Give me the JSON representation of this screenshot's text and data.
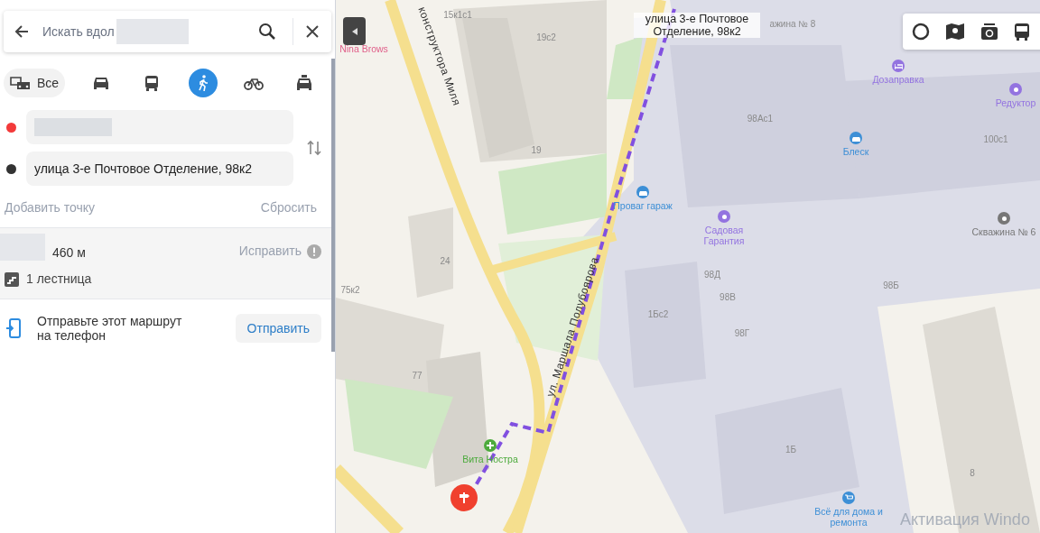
{
  "search": {
    "placeholder": "Искать вдол"
  },
  "modes": [
    {
      "kind": "all",
      "label": "Все",
      "selected": false
    },
    {
      "kind": "car",
      "selected": false
    },
    {
      "kind": "bus",
      "selected": false
    },
    {
      "kind": "walk",
      "selected": true
    },
    {
      "kind": "bike",
      "selected": false
    },
    {
      "kind": "taxi",
      "selected": false
    }
  ],
  "points": [
    {
      "color": "#f33a3a"
    },
    {
      "color": "#333333",
      "value": "улица 3-е Почтовое Отделение, 98к2"
    }
  ],
  "add_point": "Добавить точку",
  "reset": "Сбросить",
  "route": {
    "distance": "460 м",
    "fix": "Исправить",
    "stairs": "1 лестница"
  },
  "send": {
    "text": "Отправьте этот маршрут на телефон",
    "button": "Отправить"
  },
  "map_labels": [
    {
      "kind": "house",
      "text": "15к1с1"
    },
    {
      "kind": "house",
      "text": "19с2"
    },
    {
      "kind": "poi",
      "text": "Nina Brows",
      "color": "#e0608a"
    },
    {
      "kind": "street",
      "text": "конструктора Миля"
    },
    {
      "kind": "address",
      "text": "улица 3-е Почтовое Отделение, 98к2"
    },
    {
      "kind": "house",
      "text": "ажина № 8"
    },
    {
      "kind": "poi",
      "text": "Дозаправка",
      "color": "#9373e0"
    },
    {
      "kind": "poi",
      "text": "Редуктор",
      "color": "#9373e0"
    },
    {
      "kind": "house",
      "text": "98Ас1"
    },
    {
      "kind": "poi",
      "text": "Блеск",
      "color": "#3d8fd6"
    },
    {
      "kind": "house",
      "text": "100с1"
    },
    {
      "kind": "poi",
      "text": "Проваг гараж",
      "color": "#3d8fd6"
    },
    {
      "kind": "house",
      "text": "19"
    },
    {
      "kind": "poi",
      "text": "Садовая Гарантия",
      "color": "#9373e0"
    },
    {
      "kind": "poi",
      "text": "Скважина № 6",
      "color": "#777777"
    },
    {
      "kind": "house",
      "text": "24"
    },
    {
      "kind": "street",
      "text": "ул. Маршала Полубоярова"
    },
    {
      "kind": "house",
      "text": "75к2"
    },
    {
      "kind": "house",
      "text": "98Д"
    },
    {
      "kind": "house",
      "text": "98В"
    },
    {
      "kind": "house",
      "text": "98Г"
    },
    {
      "kind": "house",
      "text": "98Б"
    },
    {
      "kind": "house",
      "text": "1Бс2"
    },
    {
      "kind": "house",
      "text": "77"
    },
    {
      "kind": "poi",
      "text": "Вита Ностра",
      "color": "#4caa3c"
    },
    {
      "kind": "house",
      "text": "1Б"
    },
    {
      "kind": "house",
      "text": "8"
    },
    {
      "kind": "poi",
      "text": "Всё для дома и ремонта",
      "color": "#3d8fd6"
    }
  ],
  "os_notice": "Активация Windo"
}
